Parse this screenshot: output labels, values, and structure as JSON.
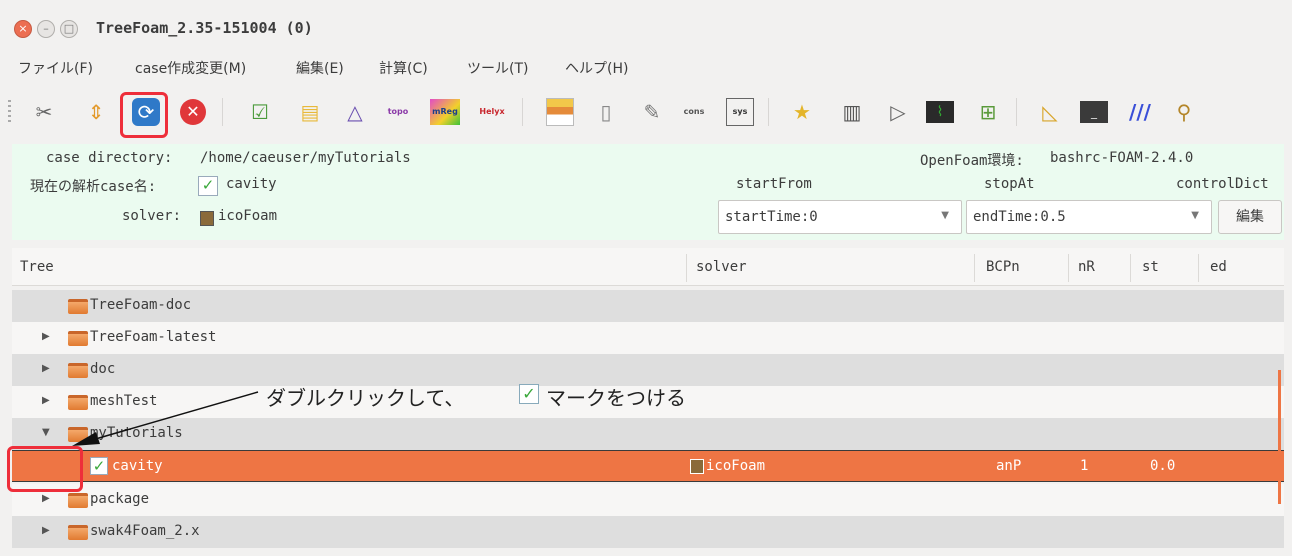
{
  "window": {
    "title": "TreeFoam_2.35-151004 (0)"
  },
  "menu": [
    "ファイル(F)",
    "case作成変更(M)",
    "編集(E)",
    "計算(C)",
    "ツール(T)",
    "ヘルプ(H)"
  ],
  "toolbar": {
    "icons": [
      "wrench-icon",
      "updown-arrows-icon",
      "refresh-icon",
      "stop-icon",
      "checklist-icon",
      "folder-arrow-icon",
      "mesh-triangle-icon",
      "topo-icon",
      "mreg-icon",
      "helyx-icon",
      "grid-icon",
      "document-icon",
      "edit-document-icon",
      "cons-icon",
      "sys-icon",
      "star-file-icon",
      "trash-icon",
      "play-icon",
      "monitor-icon",
      "blocks-icon",
      "ruler-icon",
      "terminal-icon",
      "paraview-icon",
      "antenna-icon"
    ],
    "labels": {
      "topo": "topo",
      "mreg": "mReg",
      "helyx": "Helyx",
      "cons": "cons",
      "sys": "sys"
    }
  },
  "info": {
    "case_dir_label": "case directory:",
    "case_dir": "/home/caeuser/myTutorials",
    "openfoam_label": "OpenFoam環境:",
    "openfoam_env": "bashrc-FOAM-2.4.0",
    "current_case_label": "現在の解析case名:",
    "current_case": "cavity",
    "solver_label": "solver:",
    "solver": "icoFoam",
    "start_from_label": "startFrom",
    "stop_at_label": "stopAt",
    "control_dict_label": "controlDict",
    "start_from_value": "startTime:0",
    "stop_at_value": "endTime:0.5",
    "edit_button": "編集"
  },
  "tree": {
    "columns": [
      "Tree",
      "solver",
      "BCPn",
      "nR",
      "st",
      "ed"
    ],
    "rows": [
      {
        "name": "TreeFoam-doc",
        "expander": "",
        "solver": "",
        "bcpn": "",
        "nr": "",
        "st": "",
        "ed": ""
      },
      {
        "name": "TreeFoam-latest",
        "expander": "▶",
        "solver": "",
        "bcpn": "",
        "nr": "",
        "st": "",
        "ed": ""
      },
      {
        "name": "doc",
        "expander": "▶",
        "solver": "",
        "bcpn": "",
        "nr": "",
        "st": "",
        "ed": ""
      },
      {
        "name": "meshTest",
        "expander": "▶",
        "solver": "",
        "bcpn": "",
        "nr": "",
        "st": "",
        "ed": ""
      },
      {
        "name": "myTutorials",
        "expander": "▼",
        "solver": "",
        "bcpn": "",
        "nr": "",
        "st": "",
        "ed": ""
      },
      {
        "name": "cavity",
        "expander": "",
        "solver": "icoFoam",
        "bcpn": "anP",
        "nr": "1",
        "st": "0.0",
        "ed": ""
      },
      {
        "name": "package",
        "expander": "▶",
        "solver": "",
        "bcpn": "",
        "nr": "",
        "st": "",
        "ed": ""
      },
      {
        "name": "swak4Foam_2.x",
        "expander": "▶",
        "solver": "",
        "bcpn": "",
        "nr": "",
        "st": "",
        "ed": ""
      }
    ]
  },
  "annotation": {
    "text_before": "ダブルクリックして、",
    "text_after": "マークをつける"
  },
  "colors": {
    "selected_row": "#ee7544",
    "highlight_box": "#ee2e3a",
    "info_bg": "#ebfbf0"
  }
}
